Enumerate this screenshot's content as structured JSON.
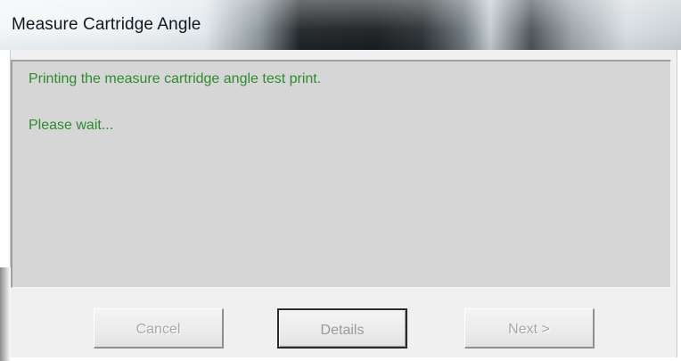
{
  "window": {
    "title": "Measure Cartridge Angle"
  },
  "message": {
    "line1": "Printing the measure cartridge angle test print.",
    "line2": "Please wait..."
  },
  "buttons": {
    "cancel": "Cancel",
    "details": "Details",
    "next": "Next >"
  },
  "colors": {
    "message_text": "#2e8b2e",
    "disabled_text": "#a8a8a8"
  }
}
